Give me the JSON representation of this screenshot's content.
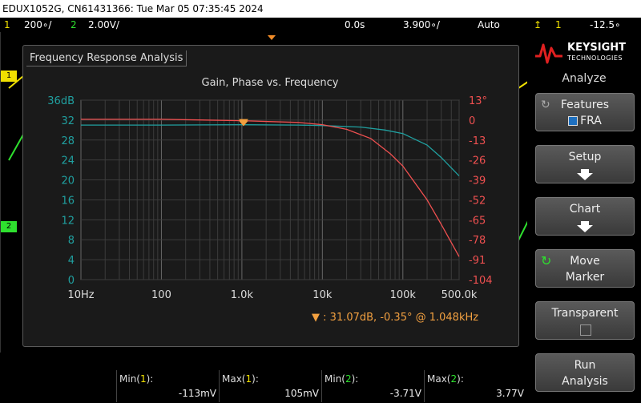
{
  "titlebar": {
    "text": "EDUX1052G, CN61431366: Tue Mar 05 07:35:45 2024"
  },
  "status": {
    "ch1_num": "1",
    "ch1_scale": "200∘/",
    "ch2_num": "2",
    "ch2_scale": "2.00V/",
    "time_pos": "0.0s",
    "timebase": "3.900∘/",
    "trigger_mode": "Auto",
    "trig_channel": "1",
    "trig_level": "-12.5∘"
  },
  "fra": {
    "window_title": "Frequency Response Analysis",
    "readout": "31.07dB, -0.35° @ 1.048kHz",
    "readout_prefix": ":"
  },
  "chart_data": {
    "type": "line",
    "title": "Gain, Phase vs. Frequency",
    "x_scale": "log",
    "xlim": [
      10,
      500000
    ],
    "x_ticks": [
      10,
      100,
      1000,
      10000,
      100000,
      500000
    ],
    "x_tick_labels": [
      "10Hz",
      "100",
      "1.0k",
      "10k",
      "100k",
      "500.0k"
    ],
    "y_left": {
      "unit": "dB",
      "lim": [
        0,
        36
      ],
      "ticks": [
        0,
        4,
        8,
        12,
        16,
        20,
        24,
        28,
        32,
        36
      ],
      "tick_labels": [
        "0",
        "4",
        "8",
        "12",
        "16",
        "20",
        "24",
        "28",
        "32",
        "36dB"
      ],
      "color": "#20a0a0"
    },
    "y_right": {
      "unit": "°",
      "lim": [
        -104,
        13
      ],
      "ticks": [
        13,
        0,
        -13,
        -26,
        -39,
        -52,
        -65,
        -78,
        -91,
        -104
      ],
      "tick_labels": [
        "13°",
        "0",
        "-13",
        "-26",
        "-39",
        "-52",
        "-65",
        "-78",
        "-91",
        "-104"
      ],
      "color": "#f05050"
    },
    "grid": true,
    "series": [
      {
        "axis": "left",
        "color": "#20a0a0",
        "x": [
          10,
          100,
          1000,
          5000,
          10000,
          30000,
          60000,
          100000,
          200000,
          300000,
          500000
        ],
        "y": [
          31.0,
          31.0,
          31.07,
          31.0,
          30.9,
          30.6,
          30.0,
          29.3,
          27.0,
          24.5,
          20.8
        ]
      },
      {
        "axis": "right",
        "color": "#f05050",
        "x": [
          10,
          100,
          1000,
          5000,
          10000,
          20000,
          40000,
          70000,
          100000,
          200000,
          300000,
          500000
        ],
        "y": [
          0.5,
          0.5,
          -0.35,
          -1.5,
          -3.0,
          -6.0,
          -12.0,
          -22.0,
          -30.0,
          -52.0,
          -68.0,
          -89.0
        ]
      }
    ],
    "marker": {
      "x": 1048,
      "gain_db": 31.07,
      "phase_deg": -0.35
    }
  },
  "sidebar": {
    "brand": "KEYSIGHT",
    "brand_sub": "TECHNOLOGIES",
    "menu_title": "Analyze",
    "features_label": "Features",
    "features_value": "FRA",
    "setup_label": "Setup",
    "chart_label": "Chart",
    "move_label": "Move",
    "marker_label": "Marker",
    "transparent_label": "Transparent",
    "run_label": "Run",
    "analysis_label": "Analysis"
  },
  "measurements": [
    {
      "label": "Min(",
      "ch": "1",
      "close": "):",
      "value": "-113mV",
      "color": "#f0e000"
    },
    {
      "label": "Max(",
      "ch": "1",
      "close": "):",
      "value": "105mV",
      "color": "#f0e000"
    },
    {
      "label": "Min(",
      "ch": "2",
      "close": "):",
      "value": "-3.71V",
      "color": "#2ee02e"
    },
    {
      "label": "Max(",
      "ch": "2",
      "close": "):",
      "value": "3.77V",
      "color": "#2ee02e"
    }
  ]
}
